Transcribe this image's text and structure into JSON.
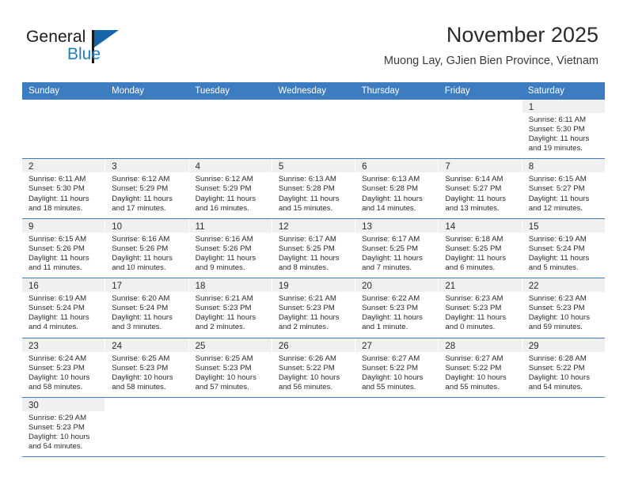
{
  "brand": {
    "name_top": "General",
    "name_bottom": "Blue",
    "accent_color": "#1c7fc4",
    "flag_color": "#1565a8"
  },
  "header": {
    "title": "November 2025",
    "subtitle": "Muong Lay, GJien Bien Province, Vietnam",
    "header_bar_color": "#3d7cc0"
  },
  "calendar": {
    "weekdays": [
      "Sunday",
      "Monday",
      "Tuesday",
      "Wednesday",
      "Thursday",
      "Friday",
      "Saturday"
    ],
    "weeks": [
      [
        {
          "day": "",
          "lines": []
        },
        {
          "day": "",
          "lines": []
        },
        {
          "day": "",
          "lines": []
        },
        {
          "day": "",
          "lines": []
        },
        {
          "day": "",
          "lines": []
        },
        {
          "day": "",
          "lines": []
        },
        {
          "day": "1",
          "lines": [
            "Sunrise: 6:11 AM",
            "Sunset: 5:30 PM",
            "Daylight: 11 hours",
            "and 19 minutes."
          ]
        }
      ],
      [
        {
          "day": "2",
          "lines": [
            "Sunrise: 6:11 AM",
            "Sunset: 5:30 PM",
            "Daylight: 11 hours",
            "and 18 minutes."
          ]
        },
        {
          "day": "3",
          "lines": [
            "Sunrise: 6:12 AM",
            "Sunset: 5:29 PM",
            "Daylight: 11 hours",
            "and 17 minutes."
          ]
        },
        {
          "day": "4",
          "lines": [
            "Sunrise: 6:12 AM",
            "Sunset: 5:29 PM",
            "Daylight: 11 hours",
            "and 16 minutes."
          ]
        },
        {
          "day": "5",
          "lines": [
            "Sunrise: 6:13 AM",
            "Sunset: 5:28 PM",
            "Daylight: 11 hours",
            "and 15 minutes."
          ]
        },
        {
          "day": "6",
          "lines": [
            "Sunrise: 6:13 AM",
            "Sunset: 5:28 PM",
            "Daylight: 11 hours",
            "and 14 minutes."
          ]
        },
        {
          "day": "7",
          "lines": [
            "Sunrise: 6:14 AM",
            "Sunset: 5:27 PM",
            "Daylight: 11 hours",
            "and 13 minutes."
          ]
        },
        {
          "day": "8",
          "lines": [
            "Sunrise: 6:15 AM",
            "Sunset: 5:27 PM",
            "Daylight: 11 hours",
            "and 12 minutes."
          ]
        }
      ],
      [
        {
          "day": "9",
          "lines": [
            "Sunrise: 6:15 AM",
            "Sunset: 5:26 PM",
            "Daylight: 11 hours",
            "and 11 minutes."
          ]
        },
        {
          "day": "10",
          "lines": [
            "Sunrise: 6:16 AM",
            "Sunset: 5:26 PM",
            "Daylight: 11 hours",
            "and 10 minutes."
          ]
        },
        {
          "day": "11",
          "lines": [
            "Sunrise: 6:16 AM",
            "Sunset: 5:26 PM",
            "Daylight: 11 hours",
            "and 9 minutes."
          ]
        },
        {
          "day": "12",
          "lines": [
            "Sunrise: 6:17 AM",
            "Sunset: 5:25 PM",
            "Daylight: 11 hours",
            "and 8 minutes."
          ]
        },
        {
          "day": "13",
          "lines": [
            "Sunrise: 6:17 AM",
            "Sunset: 5:25 PM",
            "Daylight: 11 hours",
            "and 7 minutes."
          ]
        },
        {
          "day": "14",
          "lines": [
            "Sunrise: 6:18 AM",
            "Sunset: 5:25 PM",
            "Daylight: 11 hours",
            "and 6 minutes."
          ]
        },
        {
          "day": "15",
          "lines": [
            "Sunrise: 6:19 AM",
            "Sunset: 5:24 PM",
            "Daylight: 11 hours",
            "and 5 minutes."
          ]
        }
      ],
      [
        {
          "day": "16",
          "lines": [
            "Sunrise: 6:19 AM",
            "Sunset: 5:24 PM",
            "Daylight: 11 hours",
            "and 4 minutes."
          ]
        },
        {
          "day": "17",
          "lines": [
            "Sunrise: 6:20 AM",
            "Sunset: 5:24 PM",
            "Daylight: 11 hours",
            "and 3 minutes."
          ]
        },
        {
          "day": "18",
          "lines": [
            "Sunrise: 6:21 AM",
            "Sunset: 5:23 PM",
            "Daylight: 11 hours",
            "and 2 minutes."
          ]
        },
        {
          "day": "19",
          "lines": [
            "Sunrise: 6:21 AM",
            "Sunset: 5:23 PM",
            "Daylight: 11 hours",
            "and 2 minutes."
          ]
        },
        {
          "day": "20",
          "lines": [
            "Sunrise: 6:22 AM",
            "Sunset: 5:23 PM",
            "Daylight: 11 hours",
            "and 1 minute."
          ]
        },
        {
          "day": "21",
          "lines": [
            "Sunrise: 6:23 AM",
            "Sunset: 5:23 PM",
            "Daylight: 11 hours",
            "and 0 minutes."
          ]
        },
        {
          "day": "22",
          "lines": [
            "Sunrise: 6:23 AM",
            "Sunset: 5:23 PM",
            "Daylight: 10 hours",
            "and 59 minutes."
          ]
        }
      ],
      [
        {
          "day": "23",
          "lines": [
            "Sunrise: 6:24 AM",
            "Sunset: 5:23 PM",
            "Daylight: 10 hours",
            "and 58 minutes."
          ]
        },
        {
          "day": "24",
          "lines": [
            "Sunrise: 6:25 AM",
            "Sunset: 5:23 PM",
            "Daylight: 10 hours",
            "and 58 minutes."
          ]
        },
        {
          "day": "25",
          "lines": [
            "Sunrise: 6:25 AM",
            "Sunset: 5:23 PM",
            "Daylight: 10 hours",
            "and 57 minutes."
          ]
        },
        {
          "day": "26",
          "lines": [
            "Sunrise: 6:26 AM",
            "Sunset: 5:22 PM",
            "Daylight: 10 hours",
            "and 56 minutes."
          ]
        },
        {
          "day": "27",
          "lines": [
            "Sunrise: 6:27 AM",
            "Sunset: 5:22 PM",
            "Daylight: 10 hours",
            "and 55 minutes."
          ]
        },
        {
          "day": "28",
          "lines": [
            "Sunrise: 6:27 AM",
            "Sunset: 5:22 PM",
            "Daylight: 10 hours",
            "and 55 minutes."
          ]
        },
        {
          "day": "29",
          "lines": [
            "Sunrise: 6:28 AM",
            "Sunset: 5:22 PM",
            "Daylight: 10 hours",
            "and 54 minutes."
          ]
        }
      ],
      [
        {
          "day": "30",
          "lines": [
            "Sunrise: 6:29 AM",
            "Sunset: 5:23 PM",
            "Daylight: 10 hours",
            "and 54 minutes."
          ]
        },
        {
          "day": "",
          "lines": []
        },
        {
          "day": "",
          "lines": []
        },
        {
          "day": "",
          "lines": []
        },
        {
          "day": "",
          "lines": []
        },
        {
          "day": "",
          "lines": []
        },
        {
          "day": "",
          "lines": []
        }
      ]
    ]
  }
}
